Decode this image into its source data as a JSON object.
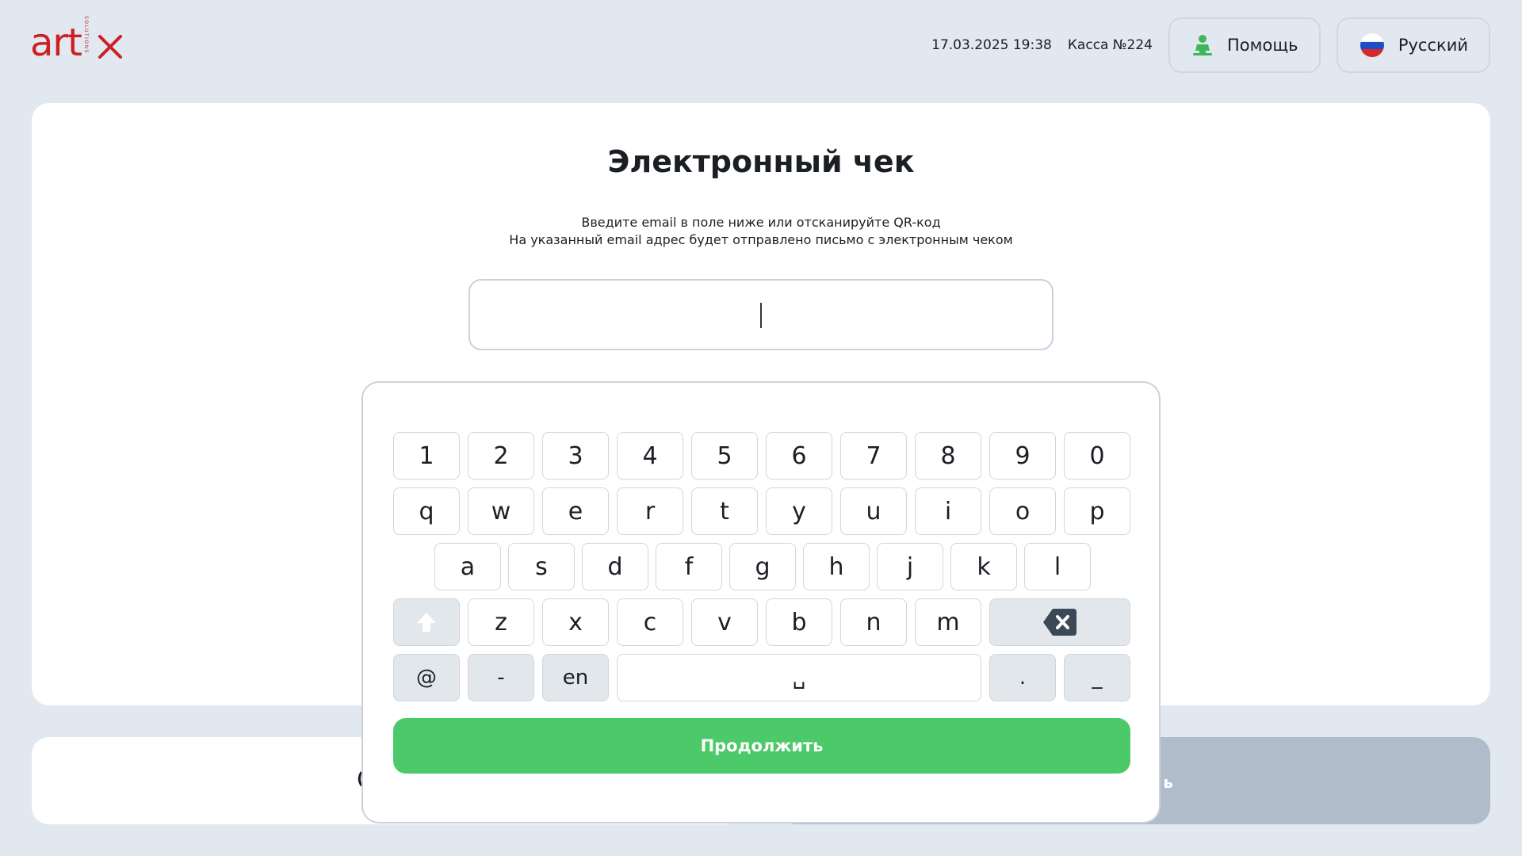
{
  "brand": {
    "logo_text": "art",
    "logo_vertical": "SOLUTIONS",
    "color": "#cc2027"
  },
  "header": {
    "datetime": "17.03.2025 19:38",
    "register": "Касса №224",
    "help_label": "Помощь",
    "help_icon": "person-help-icon",
    "language_label": "Русский",
    "language_icon": "russian-flag-icon"
  },
  "main": {
    "title": "Электронный чек",
    "subtitle_line1": "Введите email в поле ниже или отсканируйте QR-код",
    "subtitle_line2": "На указанный email адрес будет отправлено письмо с электронным чеком",
    "email_value": "",
    "email_placeholder": ""
  },
  "keyboard": {
    "row_numbers": [
      "1",
      "2",
      "3",
      "4",
      "5",
      "6",
      "7",
      "8",
      "9",
      "0"
    ],
    "row_top": [
      "q",
      "w",
      "e",
      "r",
      "t",
      "y",
      "u",
      "i",
      "o",
      "p"
    ],
    "row_middle": [
      "a",
      "s",
      "d",
      "f",
      "g",
      "h",
      "j",
      "k",
      "l"
    ],
    "row_bottom": [
      "z",
      "x",
      "c",
      "v",
      "b",
      "n",
      "m"
    ],
    "shift_icon": "shift-arrow-icon",
    "backspace_icon": "backspace-icon",
    "at_key": "@",
    "dash_key": "-",
    "lang_key": "en",
    "space_key": "␣",
    "dot_key": ".",
    "underscore_key": "_",
    "continue_label": "Продолжить"
  },
  "bottom": {
    "left_partial": "(",
    "right_partial": "ь"
  },
  "colors": {
    "background": "#e2e8ef",
    "accent_green": "#4cc968",
    "disabled_grey": "#b0bcc9",
    "brand_red": "#cc2027"
  }
}
